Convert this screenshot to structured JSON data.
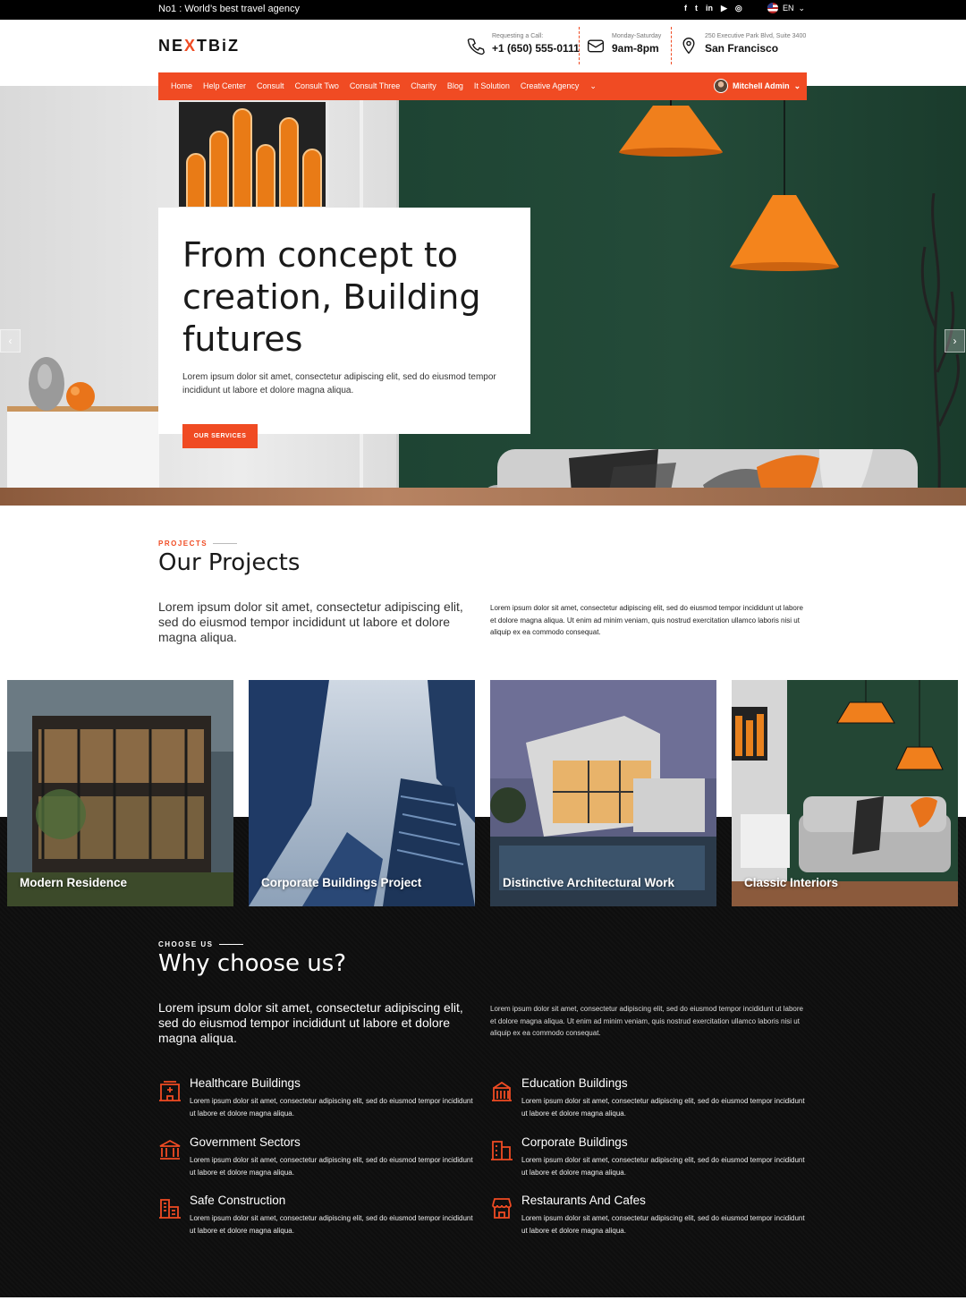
{
  "topbar": {
    "tagline": "No1 : World’s best travel agency",
    "socials": [
      "f",
      "t",
      "in",
      "▶",
      "◎"
    ],
    "language": "EN"
  },
  "header": {
    "logo": {
      "a": "NE",
      "x": "X",
      "b": "TBiZ"
    },
    "contacts": [
      {
        "icon": "phone-icon",
        "label": "Requesting a Call:",
        "value": "+1 (650) 555-0111"
      },
      {
        "icon": "clock-icon",
        "label": "Monday-Saturday",
        "value": "9am-8pm"
      },
      {
        "icon": "location-pin-icon",
        "label": "250 Executive Park Blvd, Suite 3400",
        "value": "San Francisco"
      }
    ]
  },
  "nav": {
    "items": [
      "Home",
      "Help Center",
      "Consult",
      "Consult Two",
      "Consult Three",
      "Charity",
      "Blog",
      "It Solution",
      "Creative Agency"
    ],
    "more": "⌄",
    "user": "Mitchell Admin"
  },
  "hero": {
    "title": "From concept to creation, Building futures",
    "text": "Lorem ipsum dolor sit amet, consectetur adipiscing elit, sed do eiusmod tempor incididunt ut labore et dolore magna aliqua.",
    "button": "OUR SERVICES",
    "prev": "‹",
    "next": "›"
  },
  "projects": {
    "eyebrow": "PROJECTS",
    "title": "Our Projects",
    "lead": "Lorem ipsum dolor sit amet, consectetur adipiscing elit, sed do eiusmod tempor incididunt ut labore et dolore magna aliqua.",
    "body": "Lorem ipsum dolor sit amet, consectetur adipiscing elit, sed do eiusmod tempor incididunt ut labore et dolore magna aliqua. Ut enim ad minim veniam, quis nostrud exercitation ullamco laboris nisi ut aliquip ex ea commodo consequat.",
    "cards": [
      "Modern Residence",
      "Corporate Buildings Project",
      "Distinctive Architectural Work",
      "Classic Interiors"
    ]
  },
  "why": {
    "eyebrow": "CHOOSE US",
    "title": "Why choose us?",
    "lead": "Lorem ipsum dolor sit amet, consectetur adipiscing elit, sed do eiusmod tempor incididunt ut labore et dolore magna aliqua.",
    "body": "Lorem ipsum dolor sit amet, consectetur adipiscing elit, sed do eiusmod tempor incididunt ut labore et dolore magna aliqua. Ut enim ad minim veniam, quis nostrud exercitation ullamco laboris nisi ut aliquip ex ea commodo consequat.",
    "features": [
      {
        "icon": "hospital-icon",
        "title": "Healthcare Buildings",
        "text": "Lorem ipsum dolor sit amet, consectetur adipiscing elit, sed do eiusmod tempor incididunt ut labore et dolore magna aliqua."
      },
      {
        "icon": "school-icon",
        "title": "Education Buildings",
        "text": "Lorem ipsum dolor sit amet, consectetur adipiscing elit, sed do eiusmod tempor incididunt ut labore et dolore magna aliqua."
      },
      {
        "icon": "government-icon",
        "title": "Government Sectors",
        "text": "Lorem ipsum dolor sit amet, consectetur adipiscing elit, sed do eiusmod tempor incididunt ut labore et dolore magna aliqua."
      },
      {
        "icon": "office-building-icon",
        "title": "Corporate Buildings",
        "text": "Lorem ipsum dolor sit amet, consectetur adipiscing elit, sed do eiusmod tempor incididunt ut labore et dolore magna aliqua."
      },
      {
        "icon": "construction-icon",
        "title": "Safe Construction",
        "text": "Lorem ipsum dolor sit amet, consectetur adipiscing elit, sed do eiusmod tempor incididunt ut labore et dolore magna aliqua."
      },
      {
        "icon": "store-icon",
        "title": "Restaurants And Cafes",
        "text": "Lorem ipsum dolor sit amet, consectetur adipiscing elit, sed do eiusmod tempor incididunt ut labore et dolore magna aliqua."
      }
    ]
  },
  "colors": {
    "accent": "#f04b23",
    "dark": "#111111",
    "green_wall": "#244b39"
  }
}
